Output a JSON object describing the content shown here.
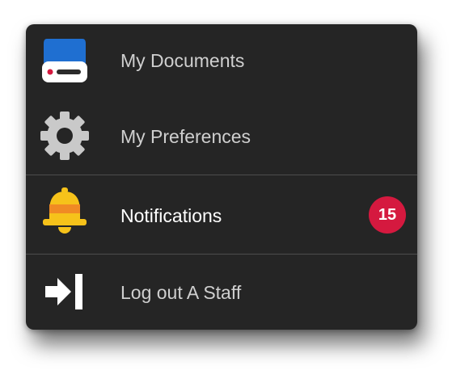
{
  "menu": {
    "items": [
      {
        "label": "My Documents",
        "icon": "drive-icon"
      },
      {
        "label": "My Preferences",
        "icon": "gear-icon"
      },
      {
        "label": "Notifications",
        "icon": "bell-icon",
        "badge": "15",
        "active": true
      },
      {
        "label": "Log out A Staff",
        "icon": "logout-icon"
      }
    ]
  },
  "colors": {
    "menu_background": "#252525",
    "badge": "#d5193f",
    "drive_blue": "#1f6fd1",
    "bell_yellow": "#f6c21a",
    "bell_orange": "#f08a24",
    "gear_gray": "#c9c9c9"
  }
}
